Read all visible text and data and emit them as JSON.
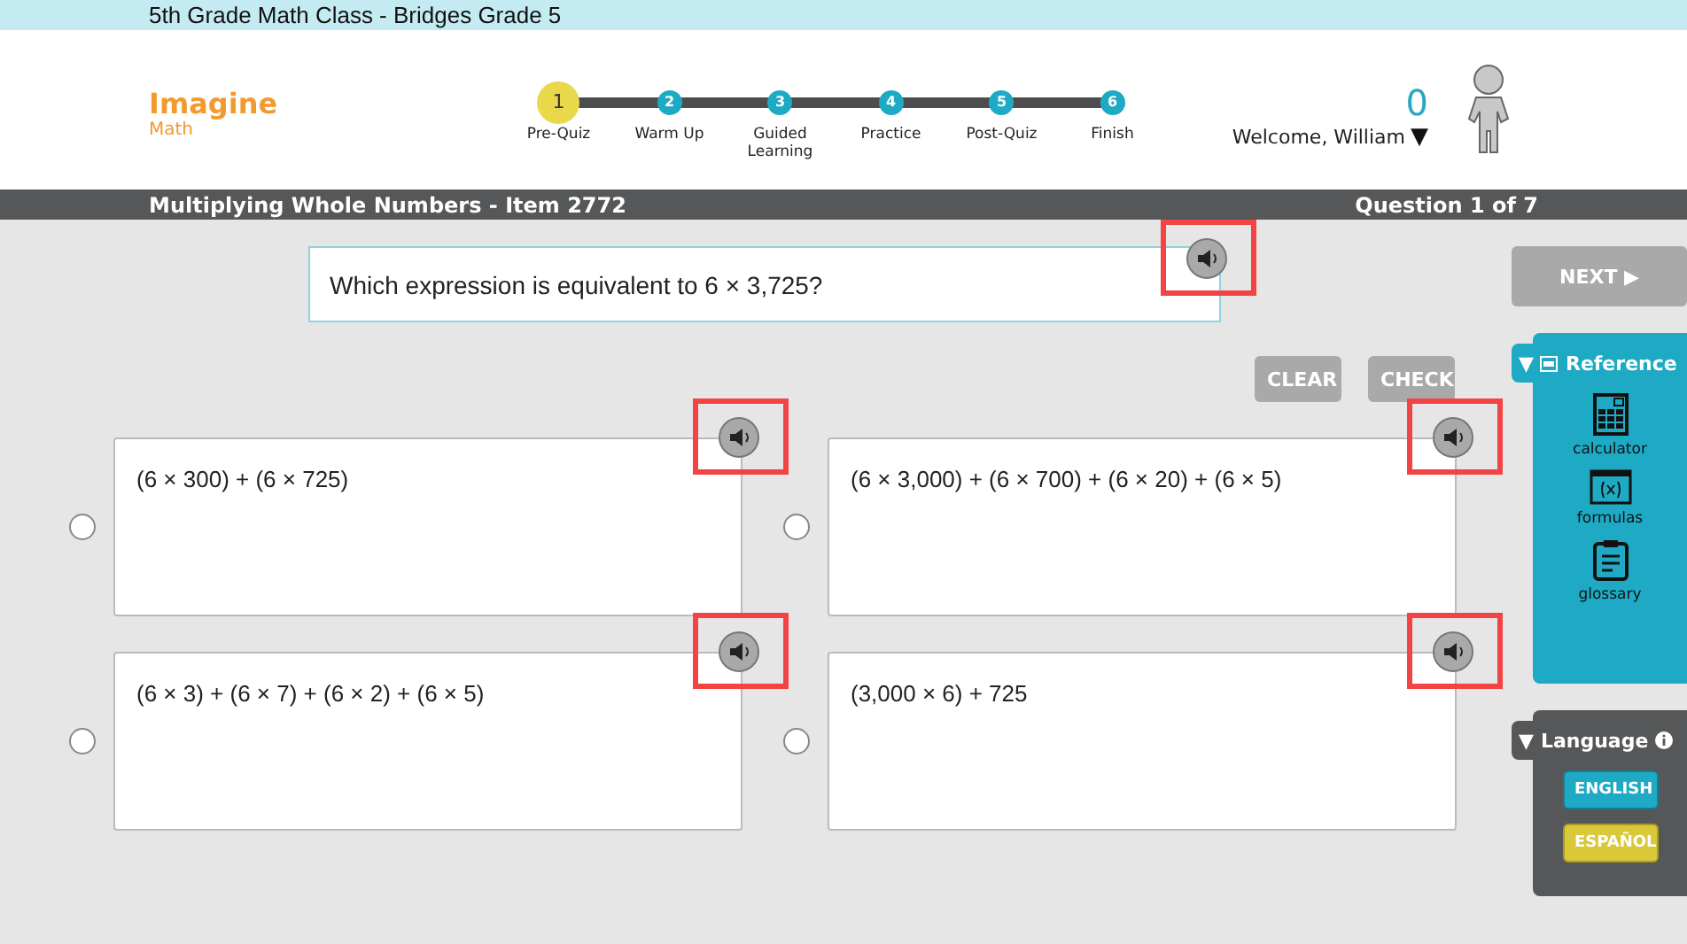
{
  "top_bar": {
    "title": "5th Grade Math Class - Bridges Grade 5"
  },
  "logo": {
    "name": "Imagine",
    "sub": "Math"
  },
  "steps": [
    {
      "number": "1",
      "label": "Pre-Quiz",
      "selected": true
    },
    {
      "number": "2",
      "label": "Warm Up",
      "selected": false
    },
    {
      "number": "3",
      "label": "Guided Learning",
      "selected": false
    },
    {
      "number": "4",
      "label": "Practice",
      "selected": false
    },
    {
      "number": "5",
      "label": "Post-Quiz",
      "selected": false
    },
    {
      "number": "6",
      "label": "Finish",
      "selected": false
    }
  ],
  "user": {
    "score": "0",
    "welcome": "Welcome, William",
    "caret": "▼"
  },
  "title_bar": {
    "lesson": "Multiplying Whole Numbers - Item 2772",
    "progress": "Question 1 of 7"
  },
  "question": {
    "text": "Which expression is equivalent to 6 × 3,725?",
    "audio_highlighted": true
  },
  "actions": [
    "CLEAR",
    "CHECK"
  ],
  "answers": [
    {
      "text": "(6 × 300) + (6 × 725)",
      "selected": false,
      "audio_highlighted": true
    },
    {
      "text": "(6 × 3,000) + (6 × 700) + (6 × 20) + (6 × 5)",
      "selected": false,
      "audio_highlighted": true
    },
    {
      "text": "(6 × 3) + (6 × 7) + (6 × 2) + (6 × 5)",
      "selected": false,
      "audio_highlighted": true
    },
    {
      "text": "(3,000 × 6) + 725",
      "selected": false,
      "audio_highlighted": true
    }
  ],
  "sidebar": {
    "next": "NEXT ▶",
    "reference": {
      "caret": "▼",
      "title": "Reference",
      "tools": [
        {
          "kind": "calculator",
          "label": "calculator"
        },
        {
          "kind": "formulas",
          "label": "formulas"
        },
        {
          "kind": "glossary",
          "label": "glossary"
        }
      ]
    },
    "language": {
      "caret": "▼",
      "title": "Language",
      "options": [
        {
          "label": "ENGLISH",
          "selected": true
        },
        {
          "label": "ESPAÑOL",
          "selected": false
        }
      ]
    }
  }
}
